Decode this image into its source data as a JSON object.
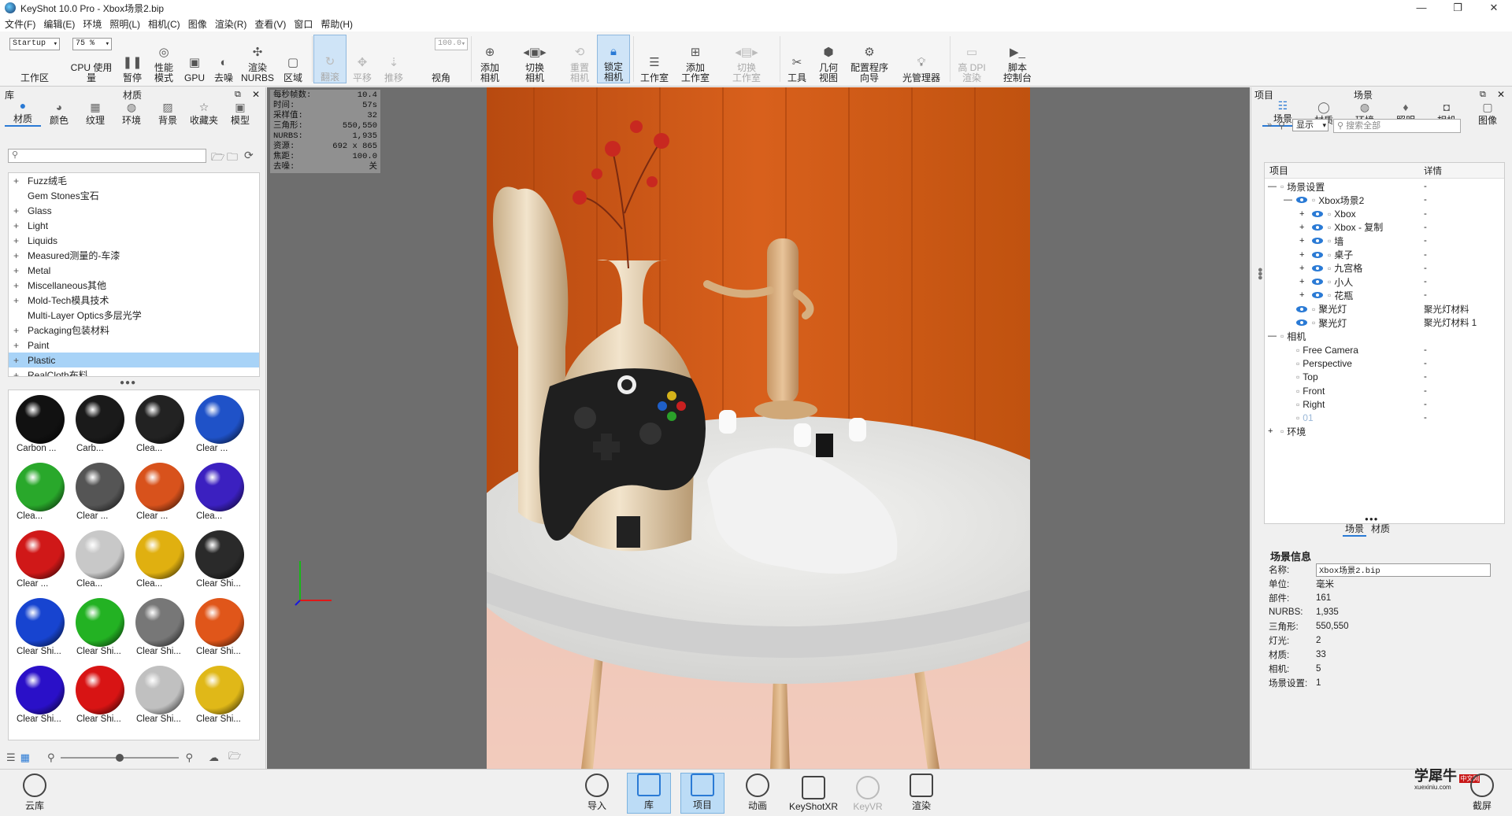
{
  "window": {
    "title": "KeyShot 10.0 Pro  - Xbox场景2.bip",
    "min": "—",
    "max": "❐",
    "close": "✕"
  },
  "menu": [
    "文件(F)",
    "编辑(E)",
    "环境",
    "照明(L)",
    "相机(C)",
    "图像",
    "渲染(R)",
    "查看(V)",
    "窗口",
    "帮助(H)"
  ],
  "toolbar": {
    "workspace_value": "Startup",
    "workspace_label": "工作区",
    "cpu_value": "75 %",
    "cpu_label": "CPU 使用量",
    "pause": "暂停",
    "perf": "性能\n模式",
    "gpu": "GPU",
    "denoise": "去噪",
    "render_nurbs": "渲染\nNURBS",
    "region": "区域",
    "tumble": "翻滚",
    "pan": "平移",
    "dolly": "推移",
    "fov_value": "100.0",
    "fov": "视角",
    "add_camera": "添加\n相机",
    "switch_camera": "切换\n相机",
    "reset_camera": "重置\n相机",
    "lock_camera": "锁定\n相机",
    "studio": "工作室",
    "add_studio": "添加\n工作室",
    "switch_studio": "切换\n工作室",
    "tools": "工具",
    "geometry_view": "几何\n视图",
    "config_wizard": "配置程序\n向导",
    "light_manager": "光管理器",
    "hi_dpi": "高 DPI\n渲染",
    "script_console": "脚本\n控制台"
  },
  "library": {
    "panel_title": "库",
    "tab_title": "材质",
    "tabs": [
      "材质",
      "颜色",
      "纹理",
      "环境",
      "背景",
      "收藏夹",
      "模型"
    ],
    "search_placeholder": "",
    "tree": [
      {
        "pm": "+",
        "label": "Fuzz绒毛"
      },
      {
        "pm": "",
        "label": "Gem Stones宝石"
      },
      {
        "pm": "+",
        "label": "Glass"
      },
      {
        "pm": "+",
        "label": "Light"
      },
      {
        "pm": "+",
        "label": "Liquids"
      },
      {
        "pm": "+",
        "label": "Measured测量的-车漆"
      },
      {
        "pm": "+",
        "label": "Metal"
      },
      {
        "pm": "+",
        "label": "Miscellaneous其他"
      },
      {
        "pm": "+",
        "label": "Mold-Tech模具技术"
      },
      {
        "pm": "",
        "label": "Multi-Layer Optics多层光学"
      },
      {
        "pm": "+",
        "label": "Packaging包装材料"
      },
      {
        "pm": "+",
        "label": "Paint"
      },
      {
        "pm": "+",
        "label": "Plastic"
      },
      {
        "pm": "+",
        "label": "RealCloth布料"
      }
    ],
    "thumbs": [
      {
        "cap": "Carbon ...",
        "color": "#111"
      },
      {
        "cap": "Carb...",
        "color": "#1a1a1a"
      },
      {
        "cap": "Clea...",
        "color": "#222"
      },
      {
        "cap": "Clear ...",
        "color": "#1f52c8"
      },
      {
        "cap": "Clea...",
        "color": "#29a82b"
      },
      {
        "cap": "Clear ...",
        "color": "#555"
      },
      {
        "cap": "Clear ...",
        "color": "#d8521c"
      },
      {
        "cap": "Clea...",
        "color": "#3b20c0"
      },
      {
        "cap": "Clear ...",
        "color": "#d01818"
      },
      {
        "cap": "Clea...",
        "color": "#c8c8c8"
      },
      {
        "cap": "Clea...",
        "color": "#e0b010"
      },
      {
        "cap": "Clear Shi...",
        "color": "#2a2a2a"
      },
      {
        "cap": "Clear Shi...",
        "color": "#1744d0"
      },
      {
        "cap": "Clear Shi...",
        "color": "#23b223"
      },
      {
        "cap": "Clear Shi...",
        "color": "#777"
      },
      {
        "cap": "Clear Shi...",
        "color": "#e0561a"
      },
      {
        "cap": "Clear Shi...",
        "color": "#2a10c8"
      },
      {
        "cap": "Clear Shi...",
        "color": "#d81414"
      },
      {
        "cap": "Clear Shi...",
        "color": "#c0c0c0"
      },
      {
        "cap": "Clear Shi...",
        "color": "#e0b818"
      }
    ]
  },
  "stats": [
    {
      "k": "每秒帧数:",
      "v": "10.4"
    },
    {
      "k": "时间:",
      "v": "57s"
    },
    {
      "k": "采样值:",
      "v": "32"
    },
    {
      "k": "三角形:",
      "v": "550,550"
    },
    {
      "k": "NURBS:",
      "v": "1,935"
    },
    {
      "k": "资源:",
      "v": "692 x 865"
    },
    {
      "k": "焦距:",
      "v": "100.0"
    },
    {
      "k": "去噪:",
      "v": "关"
    }
  ],
  "scene": {
    "panel_title": "项目",
    "tab_title": "场景",
    "tabs": [
      "场景",
      "材质",
      "环境",
      "照明",
      "相机",
      "图像"
    ],
    "display_value": "显示",
    "search_placeholder": "搜索全部",
    "col_item": "项目",
    "col_detail": "详情",
    "rows": [
      {
        "indent": 0,
        "pm": "—",
        "eye": false,
        "label": "场景设置",
        "det": "-"
      },
      {
        "indent": 1,
        "pm": "—",
        "eye": true,
        "label": "Xbox场景2",
        "det": "-"
      },
      {
        "indent": 2,
        "pm": "+",
        "eye": true,
        "label": "Xbox",
        "det": "-"
      },
      {
        "indent": 2,
        "pm": "+",
        "eye": true,
        "label": "Xbox - 复制",
        "det": "-"
      },
      {
        "indent": 2,
        "pm": "+",
        "eye": true,
        "label": "墙",
        "det": "-"
      },
      {
        "indent": 2,
        "pm": "+",
        "eye": true,
        "label": "桌子",
        "det": "-"
      },
      {
        "indent": 2,
        "pm": "+",
        "eye": true,
        "label": "九宫格",
        "det": "-"
      },
      {
        "indent": 2,
        "pm": "+",
        "eye": true,
        "label": "小人",
        "det": "-"
      },
      {
        "indent": 2,
        "pm": "+",
        "eye": true,
        "label": "花瓶",
        "det": "-"
      },
      {
        "indent": 1,
        "pm": "",
        "eye": true,
        "label": "聚光灯",
        "det": "聚光灯材料"
      },
      {
        "indent": 1,
        "pm": "",
        "eye": true,
        "label": "聚光灯",
        "det": "聚光灯材料 1"
      },
      {
        "indent": 0,
        "pm": "—",
        "eye": false,
        "label": "相机",
        "det": ""
      },
      {
        "indent": 1,
        "pm": "",
        "eye": false,
        "label": "Free Camera",
        "det": "-"
      },
      {
        "indent": 1,
        "pm": "",
        "eye": false,
        "label": "Perspective",
        "det": "-"
      },
      {
        "indent": 1,
        "pm": "",
        "eye": false,
        "label": "Top",
        "det": "-"
      },
      {
        "indent": 1,
        "pm": "",
        "eye": false,
        "label": "Front",
        "det": "-"
      },
      {
        "indent": 1,
        "pm": "",
        "eye": false,
        "label": "Right",
        "det": "-"
      },
      {
        "indent": 1,
        "pm": "",
        "eye": false,
        "label": "01",
        "det": "-"
      },
      {
        "indent": 0,
        "pm": "+",
        "eye": false,
        "label": "环境",
        "det": ""
      }
    ],
    "subtabs": [
      "场景",
      "材质"
    ],
    "info_title": "场景信息",
    "info": [
      {
        "k": "名称:",
        "v": "Xbox场景2.bip"
      },
      {
        "k": "单位:",
        "v": "毫米"
      },
      {
        "k": "部件:",
        "v": "161"
      },
      {
        "k": "NURBS:",
        "v": "1,935"
      },
      {
        "k": "三角形:",
        "v": "550,550"
      },
      {
        "k": "灯光:",
        "v": "2"
      },
      {
        "k": "材质:",
        "v": "33"
      },
      {
        "k": "相机:",
        "v": "5"
      },
      {
        "k": "场景设置:",
        "v": "1"
      }
    ]
  },
  "bottom": {
    "cloud": "云库",
    "import": "导入",
    "library": "库",
    "project": "项目",
    "animation": "动画",
    "keyshotxr": "KeyShotXR",
    "keyvr": "KeyVR",
    "render": "渲染",
    "screenshot": "截屏",
    "watermark": "学犀牛",
    "watermark_sub": "xuexiniu.com",
    "watermark_tag": "中文网"
  }
}
